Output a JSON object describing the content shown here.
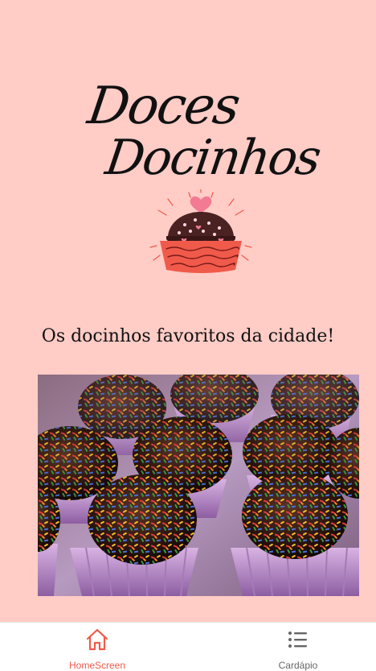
{
  "brand": {
    "line1": "Doces",
    "line2": "Docinhos"
  },
  "tagline": "Os docinhos favoritos da cidade!",
  "hero": {
    "icon": "brigadeiro-photo"
  },
  "tabbar": {
    "tabs": [
      {
        "label": "HomeScreen",
        "icon": "home-icon",
        "active": true
      },
      {
        "label": "Cardápio",
        "icon": "list-icon",
        "active": false
      }
    ]
  },
  "colors": {
    "background": "#ffccc6",
    "accent": "#f05a4a",
    "inactive": "#666666",
    "tabbar_bg": "#ffffff"
  }
}
